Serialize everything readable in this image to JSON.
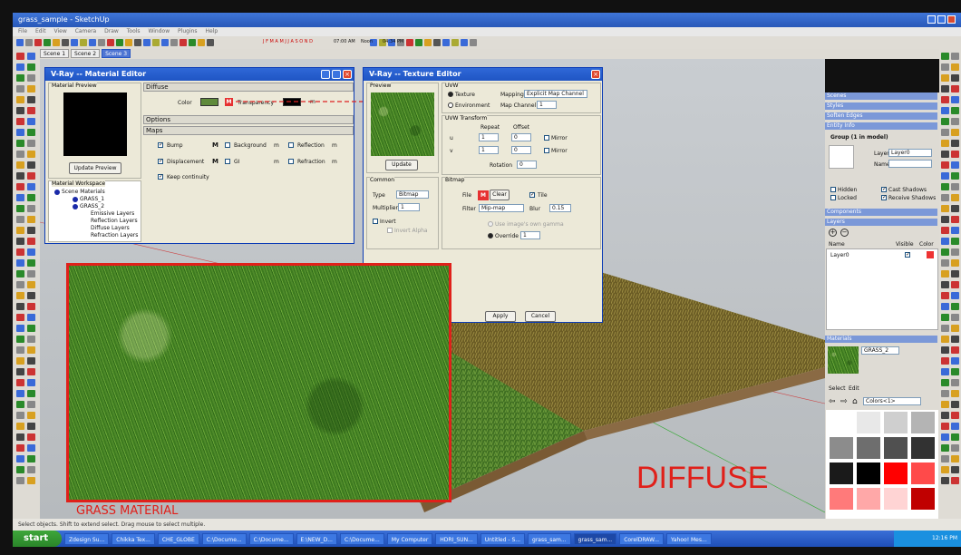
{
  "window": {
    "title": "grass_sample - SketchUp"
  },
  "menu": [
    "File",
    "Edit",
    "View",
    "Camera",
    "Draw",
    "Tools",
    "Window",
    "Plugins",
    "Help"
  ],
  "toolbar": {
    "months": "J F M A M J J A S O N D",
    "time1": "07:00 AM",
    "noon": "Noon",
    "time2": "04:34 PM"
  },
  "scenes": [
    "Scene 1",
    "Scene 2",
    "Scene 3"
  ],
  "material_editor": {
    "title": "V-Ray -- Material Editor",
    "preview_label": "Material Preview",
    "update_preview": "Update Preview",
    "workspace_label": "Material Workspace",
    "tree": [
      "Scene Materials",
      "GRASS_1",
      "GRASS_2",
      "Emissive Layers",
      "Reflection Layers",
      "Diffuse Layers",
      "Refraction Layers"
    ],
    "diffuse_header": "Diffuse",
    "color_label": "Color",
    "transparency_label": "Transparency",
    "m": "M",
    "m_lower": "m",
    "options_header": "Options",
    "maps_header": "Maps",
    "maps": {
      "bump": "Bump",
      "background": "Background",
      "reflection": "Reflection",
      "displacement": "Displacement",
      "gi": "GI",
      "refraction": "Refraction",
      "keep": "Keep continuity"
    },
    "diffuse_color": "#5f8a3a"
  },
  "texture_editor": {
    "title": "V-Ray -- Texture Editor",
    "preview_label": "Preview",
    "uvw_label": "UVW",
    "texture_opt": "Texture",
    "environment_opt": "Environment",
    "mapping_label": "Mapping",
    "mapping_value": "Explicit Map Channel",
    "map_channel_label": "Map Channel",
    "map_channel_value": "1",
    "uvw_transform_label": "UVW Transform",
    "repeat_label": "Repeat",
    "offset_label": "Offset",
    "u_label": "u",
    "v_label": "v",
    "u_repeat": "1",
    "u_offset": "0",
    "v_repeat": "1",
    "v_offset": "0",
    "mirror_label": "Mirror",
    "rotation_label": "Rotation",
    "rotation_value": "0",
    "update": "Update",
    "common_label": "Common",
    "type_label": "Type",
    "type_value": "Bitmap",
    "multiplier_label": "Multiplier",
    "multiplier_value": "1",
    "invert_label": "Invert",
    "invert_alpha_label": "Invert Alpha",
    "bitmap_label": "Bitmap",
    "file_label": "File",
    "m": "M",
    "clear": "Clear",
    "tile_label": "Tile",
    "filter_label": "Filter",
    "filter_value": "Mip-map",
    "blur_label": "Blur",
    "blur_value": "0.15",
    "gamma_label": "Use image's own gamma",
    "override_label": "Override",
    "override_value": "1",
    "apply": "Apply",
    "cancel": "Cancel"
  },
  "right_panel": {
    "tabs": [
      "Scenes",
      "Styles",
      "Soften Edges",
      "Entity Info"
    ],
    "entity_title": "Group (1 in model)",
    "layer_label": "Layer:",
    "layer_value": "Layer0",
    "name_label": "Name:",
    "hidden": "Hidden",
    "locked": "Locked",
    "cast_shadows": "Cast Shadows",
    "receive_shadows": "Receive Shadows",
    "components": "Components",
    "layers": "Layers",
    "layers_cols": {
      "name": "Name",
      "visible": "Visible",
      "color": "Color"
    },
    "layer_row": "Layer0",
    "materials": "Materials",
    "material_name": "GRASS_2",
    "select_tab": "Select",
    "edit_tab": "Edit",
    "collection": "Colors<1>",
    "colors": [
      "#ffffff",
      "#e8e8e8",
      "#cfcfcf",
      "#b4b4b4",
      "#8c8c8c",
      "#6e6e6e",
      "#505050",
      "#323232",
      "#1a1a1a",
      "#000000",
      "#ff0000",
      "#ff4a4a",
      "#ff7a7a",
      "#ffa8a8",
      "#ffd4d4",
      "#c00000",
      "#ff6a6a",
      "#ff9a9a",
      "#ffb8b8",
      "#ffd0d0"
    ]
  },
  "labels": {
    "grass_material": "GRASS MATERIAL",
    "diffuse": "DIFFUSE"
  },
  "status": "Select objects. Shift to extend select. Drag mouse to select multiple.",
  "taskbar": {
    "start": "start",
    "tasks": [
      "Zdesign Su...",
      "Chikka Tex...",
      "CHE_GLOBE",
      "C:\\Docume...",
      "C:\\Docume...",
      "E:\\NEW_D...",
      "C:\\Docume...",
      "My Computer",
      "HDRI_SUN...",
      "Untitled - S...",
      "grass_sam...",
      "grass_sam...",
      "CorelDRAW...",
      "Yahoo! Mes..."
    ],
    "clock": "12:16 PM"
  }
}
